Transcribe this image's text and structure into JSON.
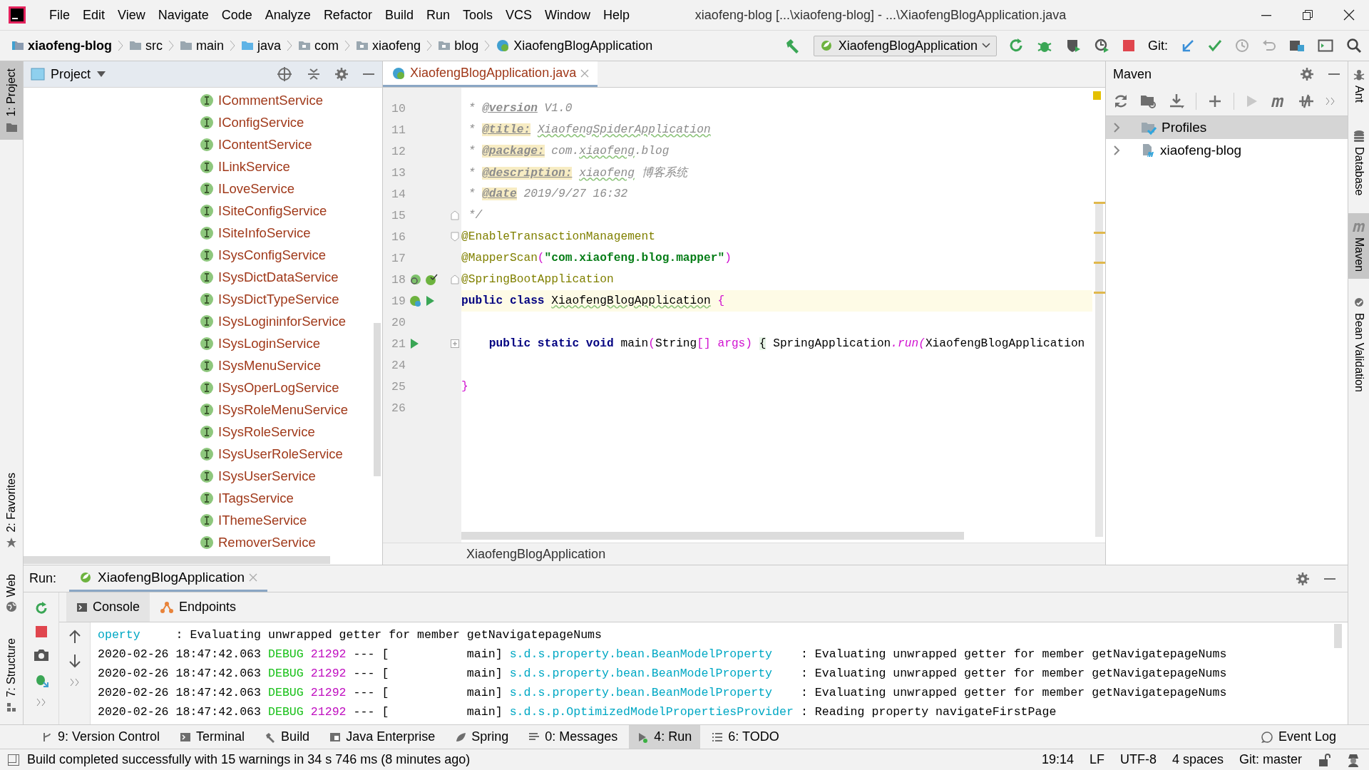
{
  "window": {
    "title": "xiaofeng-blog [...\\xiaofeng-blog] - ...\\XiaofengBlogApplication.java"
  },
  "menu": [
    "File",
    "Edit",
    "View",
    "Navigate",
    "Code",
    "Analyze",
    "Refactor",
    "Build",
    "Run",
    "Tools",
    "VCS",
    "Window",
    "Help"
  ],
  "breadcrumbs": [
    {
      "label": "xiaofeng-blog",
      "kind": "project"
    },
    {
      "label": "src",
      "kind": "folder"
    },
    {
      "label": "main",
      "kind": "folder"
    },
    {
      "label": "java",
      "kind": "source"
    },
    {
      "label": "com",
      "kind": "package"
    },
    {
      "label": "xiaofeng",
      "kind": "package"
    },
    {
      "label": "blog",
      "kind": "package"
    },
    {
      "label": "XiaofengBlogApplication",
      "kind": "class"
    }
  ],
  "run_configuration": "XiaofengBlogApplication",
  "vcs_label": "Git:",
  "left_tool_windows_top": [
    {
      "label": "1: Project",
      "kind": "project",
      "selected": true
    }
  ],
  "left_tool_windows_bottom": [
    {
      "label": "2: Favorites",
      "kind": "favorites",
      "selected": false
    },
    {
      "label": "Web",
      "kind": "web",
      "selected": false
    },
    {
      "label": "7: Structure",
      "kind": "structure",
      "selected": false
    }
  ],
  "project_panel": {
    "title": "Project",
    "items": [
      "ICommentService",
      "IConfigService",
      "IContentService",
      "ILinkService",
      "ILoveService",
      "ISiteConfigService",
      "ISiteInfoService",
      "ISysConfigService",
      "ISysDictDataService",
      "ISysDictTypeService",
      "ISysLogininforService",
      "ISysLoginService",
      "ISysMenuService",
      "ISysOperLogService",
      "ISysRoleMenuService",
      "ISysRoleService",
      "ISysUserRoleService",
      "ISysUserService",
      "ITagsService",
      "IThemeService",
      "RemoverService"
    ]
  },
  "editor": {
    "tab": {
      "label": "XiaofengBlogApplication.java",
      "selected": true
    },
    "lines": [
      {
        "number": "10",
        "current": false,
        "tokens": [
          {
            "kind": "doc",
            "text": " * "
          },
          {
            "kind": "doc-tag",
            "text": "@version"
          },
          {
            "kind": "doc",
            "text": " V1.0"
          }
        ]
      },
      {
        "number": "11",
        "current": false,
        "tokens": [
          {
            "kind": "doc",
            "text": " * "
          },
          {
            "kind": "doc-tag-marked",
            "text": "@title:"
          },
          {
            "kind": "doc-typo",
            "text": "XiaofengSpiderApplication",
            "space_before": true
          }
        ]
      },
      {
        "number": "12",
        "current": false,
        "tokens": [
          {
            "kind": "doc",
            "text": " * "
          },
          {
            "kind": "doc-tag-marked",
            "text": "@package:"
          },
          {
            "kind": "doc",
            "text": " com."
          },
          {
            "kind": "doc-typo",
            "text": "xiaofeng"
          },
          {
            "kind": "doc",
            "text": ".blog"
          }
        ]
      },
      {
        "number": "13",
        "current": false,
        "tokens": [
          {
            "kind": "doc",
            "text": " * "
          },
          {
            "kind": "doc-tag-marked",
            "text": "@description:"
          },
          {
            "kind": "doc-typo",
            "text": "xiaofeng",
            "space_before": true
          },
          {
            "kind": "doc",
            "text": " 博客系统"
          }
        ]
      },
      {
        "number": "14",
        "current": false,
        "tokens": [
          {
            "kind": "doc",
            "text": " * "
          },
          {
            "kind": "doc-tag-marked",
            "text": "@date"
          },
          {
            "kind": "doc",
            "text": " 2019/9/27 16:32"
          }
        ]
      },
      {
        "number": "15",
        "current": false,
        "fold": {
          "kind": "end"
        },
        "tokens": [
          {
            "kind": "doc",
            "text": " */"
          }
        ]
      },
      {
        "number": "16",
        "current": false,
        "fold": {
          "kind": "start"
        },
        "tokens": [
          {
            "kind": "annotation",
            "text": "@EnableTransactionManagement"
          }
        ]
      },
      {
        "number": "17",
        "current": false,
        "tokens": [
          {
            "kind": "annotation",
            "text": "@MapperScan"
          },
          {
            "kind": "bracket",
            "text": "("
          },
          {
            "kind": "string",
            "text": "\"com.xiaofeng.blog.mapper\""
          },
          {
            "kind": "bracket",
            "text": ")"
          }
        ]
      },
      {
        "number": "18",
        "current": false,
        "fold": {
          "kind": "end"
        },
        "gutter": [
          {
            "kind": "bean-search"
          },
          {
            "kind": "bean-check"
          }
        ],
        "tokens": [
          {
            "kind": "annotation",
            "text": "@SpringBootApplication"
          }
        ]
      },
      {
        "number": "19",
        "current": true,
        "gutter": [
          {
            "kind": "bean-run"
          },
          {
            "kind": "run"
          }
        ],
        "tokens": [
          {
            "kind": "keyword",
            "text": "public class"
          },
          {
            "kind": "plain-typo",
            "text": "XiaofengBlogApplication",
            "space_before": true
          },
          {
            "kind": "bracket",
            "text": "{",
            "space_before": true
          }
        ]
      },
      {
        "number": "20",
        "current": false
      },
      {
        "number": "21",
        "current": false,
        "indented": true,
        "fold": {
          "kind": "collapsed"
        },
        "gutter": [
          {
            "kind": "run"
          }
        ],
        "tokens": [
          {
            "kind": "keyword",
            "text": "public static void"
          },
          {
            "kind": "plain",
            "text": " main"
          },
          {
            "kind": "bracket",
            "text": "("
          },
          {
            "kind": "plain",
            "text": "String"
          },
          {
            "kind": "bracket",
            "text": "[]"
          },
          {
            "kind": "bracket",
            "text": "args)",
            "space_before": true
          },
          {
            "kind": "folded",
            "text": "{",
            "space_before": true
          },
          {
            "kind": "plain",
            "text": " SpringApplication"
          },
          {
            "kind": "method",
            "text": ".run("
          },
          {
            "kind": "plain",
            "text": "XiaofengBlogApplication"
          }
        ]
      },
      {
        "number": "24",
        "current": false
      },
      {
        "number": "25",
        "current": false,
        "tokens": [
          {
            "kind": "bracket",
            "text": "}"
          }
        ]
      },
      {
        "number": "26",
        "current": false
      }
    ],
    "footer": "XiaofengBlogApplication"
  },
  "maven": {
    "title": "Maven",
    "items": [
      {
        "label": "Profiles",
        "kind": "profiles",
        "selected": true,
        "expanded": false
      },
      {
        "label": "xiaofeng-blog",
        "kind": "module",
        "selected": false,
        "expanded": false
      }
    ]
  },
  "right_tool_windows": [
    {
      "label": "Ant",
      "kind": "ant",
      "selected": false
    },
    {
      "label": "Database",
      "kind": "database",
      "selected": false
    },
    {
      "label": "Maven",
      "kind": "maven",
      "selected": true
    },
    {
      "label": "Bean Validation",
      "kind": "bean",
      "selected": false
    }
  ],
  "run_panel": {
    "label": "Run:",
    "tab": {
      "label": "XiaofengBlogApplication",
      "selected": true
    },
    "subtabs": [
      {
        "label": "Console",
        "kind": "console",
        "selected": true
      },
      {
        "label": "Endpoints",
        "kind": "endpoints",
        "selected": false
      }
    ],
    "console": [
      {
        "kind": "continuation",
        "logger": "operty",
        "message": ": Evaluating unwrapped getter for member getNavigatepageNums"
      },
      {
        "kind": "entry",
        "timestamp": "2020-02-26 18:47:42.063",
        "level": "DEBUG",
        "pid": "21292",
        "separator": "---",
        "thread": "[           main]",
        "logger": "s.d.s.property.bean.BeanModelProperty",
        "message": ": Evaluating unwrapped getter for member getNavigatepageNums"
      },
      {
        "kind": "entry",
        "timestamp": "2020-02-26 18:47:42.063",
        "level": "DEBUG",
        "pid": "21292",
        "separator": "---",
        "thread": "[           main]",
        "logger": "s.d.s.property.bean.BeanModelProperty",
        "message": ": Evaluating unwrapped getter for member getNavigatepageNums"
      },
      {
        "kind": "entry",
        "timestamp": "2020-02-26 18:47:42.063",
        "level": "DEBUG",
        "pid": "21292",
        "separator": "---",
        "thread": "[           main]",
        "logger": "s.d.s.property.bean.BeanModelProperty",
        "message": ": Evaluating unwrapped getter for member getNavigatepageNums"
      },
      {
        "kind": "entry",
        "timestamp": "2020-02-26 18:47:42.063",
        "level": "DEBUG",
        "pid": "21292",
        "separator": "---",
        "thread": "[           main]",
        "logger": "s.d.s.p.OptimizedModelPropertiesProvider",
        "message": ": Reading property navigateFirstPage"
      }
    ]
  },
  "bottom_tool_windows": [
    {
      "label": "9: Version Control",
      "kind": "vcs",
      "selected": false
    },
    {
      "label": "Terminal",
      "kind": "terminal",
      "selected": false
    },
    {
      "label": "Build",
      "kind": "build",
      "selected": false
    },
    {
      "label": "Java Enterprise",
      "kind": "enterprise",
      "selected": false
    },
    {
      "label": "Spring",
      "kind": "spring",
      "selected": false
    },
    {
      "label": "0: Messages",
      "kind": "messages",
      "selected": false
    },
    {
      "label": "4: Run",
      "kind": "run",
      "selected": true
    },
    {
      "label": "6: TODO",
      "kind": "todo",
      "selected": false
    }
  ],
  "event_log": "Event Log",
  "status_bar": {
    "message": "Build completed successfully with 15 warnings in 34 s 746 ms (8 minutes ago)",
    "items": [
      "19:14",
      "LF",
      "UTF-8",
      "4 spaces",
      "Git: master"
    ]
  }
}
